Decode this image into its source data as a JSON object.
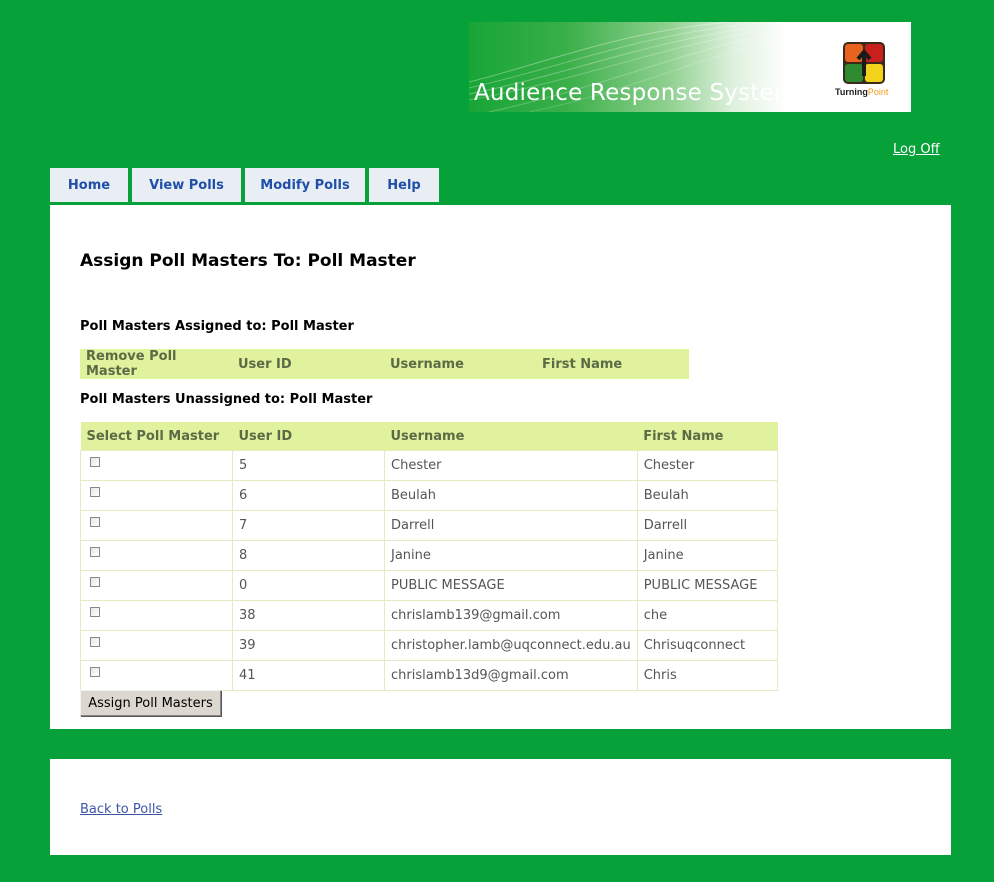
{
  "banner": {
    "title": "Audience Response Systems",
    "logo_name": "Turning",
    "logo_accent": "Point"
  },
  "header": {
    "logoff_label": "Log Off"
  },
  "tabs": [
    {
      "label": "Home"
    },
    {
      "label": "View Polls"
    },
    {
      "label": "Modify Polls"
    },
    {
      "label": "Help"
    }
  ],
  "main": {
    "title": "Assign Poll Masters To: Poll Master",
    "assigned": {
      "heading": "Poll Masters Assigned to: Poll Master",
      "columns": [
        "Remove Poll Master",
        "User ID",
        "Username",
        "First Name"
      ]
    },
    "unassigned": {
      "heading": "Poll Masters Unassigned to: Poll Master",
      "columns": [
        "Select Poll Master",
        "User ID",
        "Username",
        "First Name"
      ],
      "rows": [
        {
          "checked": false,
          "user_id": "5",
          "username": "Chester",
          "first_name": "Chester"
        },
        {
          "checked": false,
          "user_id": "6",
          "username": "Beulah",
          "first_name": "Beulah"
        },
        {
          "checked": false,
          "user_id": "7",
          "username": "Darrell",
          "first_name": "Darrell"
        },
        {
          "checked": false,
          "user_id": "8",
          "username": "Janine",
          "first_name": "Janine"
        },
        {
          "checked": false,
          "user_id": "0",
          "username": "PUBLIC MESSAGE",
          "first_name": "PUBLIC MESSAGE"
        },
        {
          "checked": false,
          "user_id": "38",
          "username": "chrislamb139@gmail.com",
          "first_name": "che"
        },
        {
          "checked": false,
          "user_id": "39",
          "username": "christopher.lamb@uqconnect.edu.au",
          "first_name": "Chrisuqconnect"
        },
        {
          "checked": false,
          "user_id": "41",
          "username": "chrislamb13d9@gmail.com",
          "first_name": "Chris"
        }
      ]
    },
    "assign_button_label": "Assign Poll Masters"
  },
  "footer": {
    "back_link_label": "Back to Polls"
  },
  "colors": {
    "background": "#07a13a",
    "table_header": "#e1f29e",
    "tab_text": "#1f4fa8",
    "link": "#3b55a5"
  }
}
